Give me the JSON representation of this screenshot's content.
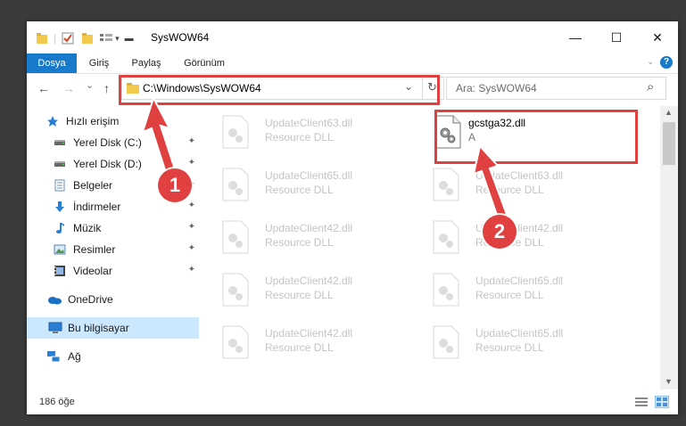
{
  "window": {
    "title": "SysWOW64",
    "controls": {
      "minimize": "—",
      "maximize": "☐",
      "close": "✕"
    }
  },
  "ribbon": {
    "tabs": [
      {
        "label": "Dosya",
        "active": true
      },
      {
        "label": "Giriş"
      },
      {
        "label": "Paylaş"
      },
      {
        "label": "Görünüm"
      }
    ],
    "help_icon": "?"
  },
  "nav": {
    "back": "←",
    "forward": "→",
    "recent": "⌄",
    "up": "↑",
    "address": "C:\\Windows\\SysWOW64",
    "address_dropdown": "⌄",
    "refresh": "↻",
    "search_placeholder": "Ara: SysWOW64",
    "search_icon": "⌕"
  },
  "sidebar": {
    "items": [
      {
        "label": "Hızlı erişim",
        "icon": "star-icon",
        "pinned": false
      },
      {
        "label": "Yerel Disk (C:)",
        "icon": "drive-icon",
        "pinned": true
      },
      {
        "label": "Yerel Disk (D:)",
        "icon": "drive-icon",
        "pinned": true
      },
      {
        "label": "Belgeler",
        "icon": "document-icon",
        "pinned": true
      },
      {
        "label": "İndirmeler",
        "icon": "download-icon",
        "pinned": true
      },
      {
        "label": "Müzik",
        "icon": "music-icon",
        "pinned": true
      },
      {
        "label": "Resimler",
        "icon": "pictures-icon",
        "pinned": true
      },
      {
        "label": "Videolar",
        "icon": "video-icon",
        "pinned": true
      },
      {
        "label": "OneDrive",
        "icon": "cloud-icon",
        "pinned": false
      },
      {
        "label": "Bu bilgisayar",
        "icon": "computer-icon",
        "pinned": false,
        "selected": true
      },
      {
        "label": "Ağ",
        "icon": "network-icon",
        "pinned": false
      }
    ],
    "pin_glyph": "📌"
  },
  "files": {
    "left_column": [
      {
        "name": "UpdateClient63.dll",
        "desc": "Resource DLL"
      },
      {
        "name": "UpdateClient65.dll",
        "desc": "Resource DLL"
      },
      {
        "name": "UpdateClient42.dll",
        "desc": "Resource DLL"
      },
      {
        "name": "UpdateClient42.dll",
        "desc": "Resource DLL"
      },
      {
        "name": "UpdateClient42.dll",
        "desc": "Resource DLL"
      }
    ],
    "right_column": [
      {
        "name": "gcstga32.dll",
        "desc": "A",
        "highlighted": true
      },
      {
        "name": "UpdateClient63.dll",
        "desc": "Resource DLL"
      },
      {
        "name": "UpdateClient42.dll",
        "desc": "Resource DLL"
      },
      {
        "name": "UpdateClient65.dll",
        "desc": "Resource DLL"
      },
      {
        "name": "UpdateClient65.dll",
        "desc": "Resource DLL"
      }
    ]
  },
  "status": {
    "count": "186 öğe"
  },
  "annotations": {
    "step1": "1",
    "step2": "2",
    "color": "#e04040"
  }
}
